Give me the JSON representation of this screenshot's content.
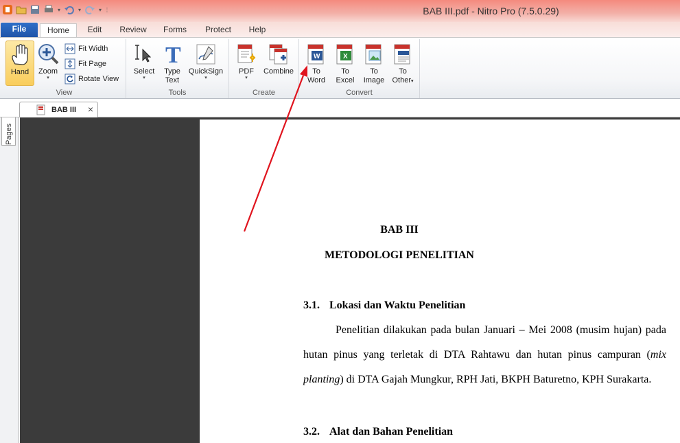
{
  "window": {
    "title": "BAB III.pdf - Nitro Pro (7.5.0.29)"
  },
  "menu_tabs": [
    "File",
    "Home",
    "Edit",
    "Review",
    "Forms",
    "Protect",
    "Help"
  ],
  "ribbon": {
    "view": {
      "label": "View",
      "hand": "Hand",
      "zoom": "Zoom",
      "fit_width": "Fit Width",
      "fit_page": "Fit Page",
      "rotate_view": "Rotate View"
    },
    "tools": {
      "label": "Tools",
      "select": "Select",
      "type_text_1": "Type",
      "type_text_2": "Text",
      "quicksign": "QuickSign"
    },
    "create": {
      "label": "Create",
      "pdf": "PDF",
      "combine": "Combine"
    },
    "convert": {
      "label": "Convert",
      "to_word_1": "To",
      "to_word_2": "Word",
      "to_excel_1": "To",
      "to_excel_2": "Excel",
      "to_image_1": "To",
      "to_image_2": "Image",
      "to_other_1": "To",
      "to_other_2": "Other"
    }
  },
  "side_panel": {
    "pages_label": "Pages"
  },
  "document_tab": {
    "name": "BAB III"
  },
  "document": {
    "chapter": "BAB III",
    "chapter_title": "METODOLOGI PENELITIAN",
    "section_1": {
      "number": "3.1.",
      "title": "Lokasi dan Waktu Penelitian"
    },
    "paragraph_1": {
      "text_a": "Penelitian dilakukan pada bulan Januari – Mei 2008 (musim hujan) pada hutan pinus yang terletak di DTA Rahtawu dan hutan pinus campuran (",
      "italic_a": "mix planting",
      "text_b": ") di DTA Gajah Mungkur, RPH Jati, BKPH Baturetno, KPH Surakarta."
    },
    "section_2": {
      "number": "3.2.",
      "title": "Alat dan Bahan Penelitian"
    }
  },
  "colors": {
    "title_bar": "#f48a7e",
    "file_tab": "#2f6fc8",
    "annotation_arrow": "#e0141e",
    "dark_background": "#3b3b3b"
  }
}
